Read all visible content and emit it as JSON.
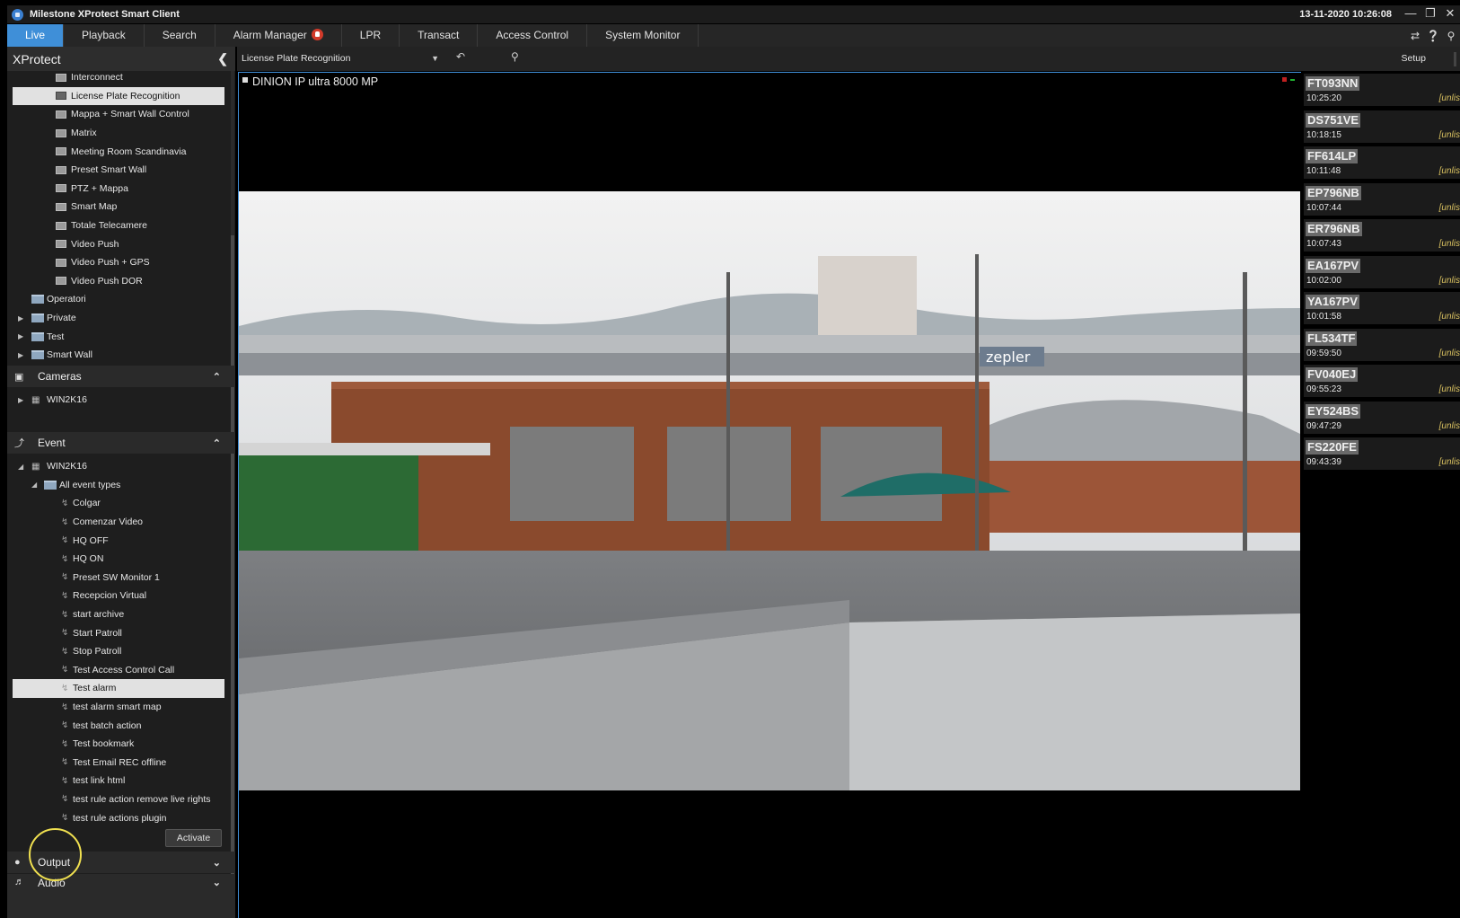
{
  "window": {
    "title": "Milestone XProtect Smart Client",
    "datetime": "13-11-2020 10:26:08"
  },
  "tabs": [
    {
      "label": "Live",
      "active": true
    },
    {
      "label": "Playback"
    },
    {
      "label": "Search"
    },
    {
      "label": "Alarm Manager",
      "badge": "alarm-bell-icon"
    },
    {
      "label": "LPR"
    },
    {
      "label": "Transact"
    },
    {
      "label": "Access Control"
    },
    {
      "label": "System Monitor"
    }
  ],
  "sidebar": {
    "brand": "XProtect",
    "views": [
      {
        "label": "Interconnect"
      },
      {
        "label": "License Plate Recognition",
        "selected": true
      },
      {
        "label": "Mappa + Smart Wall Control"
      },
      {
        "label": "Matrix"
      },
      {
        "label": "Meeting Room Scandinavia"
      },
      {
        "label": "Preset Smart Wall"
      },
      {
        "label": "PTZ + Mappa"
      },
      {
        "label": "Smart Map"
      },
      {
        "label": "Totale Telecamere"
      },
      {
        "label": "Video Push"
      },
      {
        "label": "Video Push + GPS"
      },
      {
        "label": "Video Push DOR"
      }
    ],
    "folders": [
      {
        "label": "Operatori"
      },
      {
        "label": "Private"
      },
      {
        "label": "Test"
      },
      {
        "label": "Smart Wall"
      }
    ],
    "cameras": {
      "title": "Cameras",
      "server": "WIN2K16"
    },
    "event": {
      "title": "Event",
      "server": "WIN2K16",
      "group": "All event types",
      "items": [
        "Colgar",
        "Comenzar Video",
        "HQ OFF",
        "HQ ON",
        "Preset SW Monitor 1",
        "Recepcion Virtual",
        "start archive",
        "Start Patroll",
        "Stop Patroll",
        "Test Access Control Call",
        "Test alarm",
        "test alarm smart map",
        "test batch action",
        "Test bookmark",
        "Test Email REC offline",
        "test link html",
        "test rule action remove live rights",
        "test rule actions plugin"
      ],
      "selected": "Test alarm",
      "activate_label": "Activate"
    },
    "output": {
      "title": "Output"
    },
    "audio": {
      "title": "Audio"
    }
  },
  "toolbar": {
    "view_name": "License Plate Recognition",
    "setup_label": "Setup"
  },
  "camera": {
    "title": "DINION IP ultra 8000 MP",
    "sign_text": "zepler"
  },
  "lpr": {
    "plates": [
      {
        "plate": "FT093NN",
        "time": "10:25:20",
        "list": "[unlis"
      },
      {
        "plate": "DS751VE",
        "time": "10:18:15",
        "list": "[unlis"
      },
      {
        "plate": "FF614LP",
        "time": "10:11:48",
        "list": "[unlis"
      },
      {
        "plate": "EP796NB",
        "time": "10:07:44",
        "list": "[unlis"
      },
      {
        "plate": "ER796NB",
        "time": "10:07:43",
        "list": "[unlis"
      },
      {
        "plate": "EA167PV",
        "time": "10:02:00",
        "list": "[unlis"
      },
      {
        "plate": "YA167PV",
        "time": "10:01:58",
        "list": "[unlis"
      },
      {
        "plate": "FL534TF",
        "time": "09:59:50",
        "list": "[unlis"
      },
      {
        "plate": "FV040EJ",
        "time": "09:55:23",
        "list": "[unlis"
      },
      {
        "plate": "EY524BS",
        "time": "09:47:29",
        "list": "[unlis"
      },
      {
        "plate": "FS220FE",
        "time": "09:43:39",
        "list": "[unlis"
      }
    ]
  },
  "colors": {
    "accent": "#3f8fd8",
    "panel": "#1e1e1e",
    "selected_row": "#e1e1e1",
    "alarm_badge": "#d23a2a"
  }
}
